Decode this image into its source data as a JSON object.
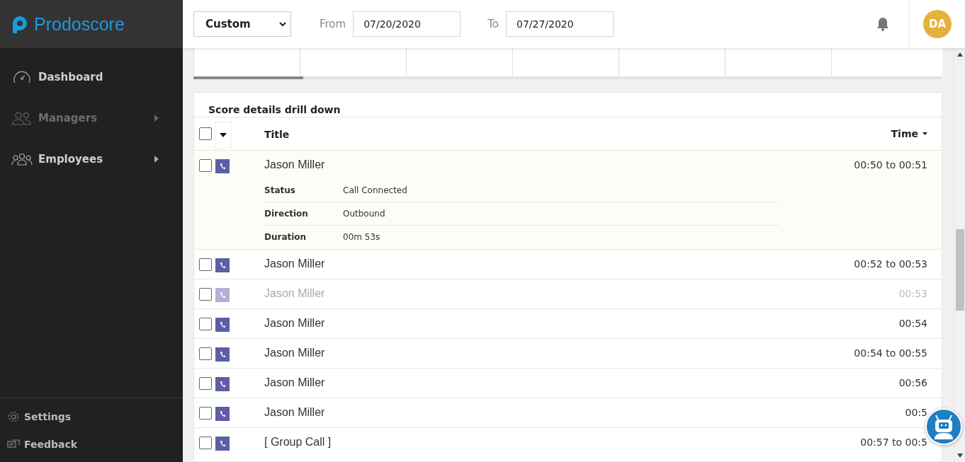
{
  "brand": {
    "name": "Prodoscore"
  },
  "sidebar": {
    "items": [
      {
        "label": "Dashboard",
        "disabled": false,
        "submenu": false
      },
      {
        "label": "Managers",
        "disabled": true,
        "submenu": true
      },
      {
        "label": "Employees",
        "disabled": false,
        "submenu": true
      }
    ],
    "footer": [
      {
        "label": "Settings"
      },
      {
        "label": "Feedback"
      }
    ]
  },
  "topbar": {
    "range": "Custom",
    "from_label": "From",
    "from": "07/20/2020",
    "to_label": "To",
    "to": "07/27/2020",
    "avatar": "DA"
  },
  "drilldown": {
    "title": "Score details drill down",
    "select_all": {
      "checked": false
    },
    "columns": {
      "title": "Title",
      "time": "Time"
    },
    "rows": [
      {
        "title": "Jason Miller",
        "time": "00:50 to 00:51",
        "checked": false,
        "disabled": false,
        "expanded": true,
        "details": [
          {
            "label": "Status",
            "value": "Call Connected"
          },
          {
            "label": "Direction",
            "value": "Outbound"
          },
          {
            "label": "Duration",
            "value": "00m 53s"
          }
        ]
      },
      {
        "title": "Jason Miller",
        "time": "00:52 to 00:53",
        "checked": false,
        "disabled": false,
        "expanded": false
      },
      {
        "title": "Jason Miller",
        "time": "00:53",
        "checked": false,
        "disabled": true,
        "expanded": false
      },
      {
        "title": "Jason Miller",
        "time": "00:54",
        "checked": false,
        "disabled": false,
        "expanded": false
      },
      {
        "title": "Jason Miller",
        "time": "00:54 to 00:55",
        "checked": false,
        "disabled": false,
        "expanded": false
      },
      {
        "title": "Jason Miller",
        "time": "00:56",
        "checked": false,
        "disabled": false,
        "expanded": false
      },
      {
        "title": "Jason Miller",
        "time": "00:5",
        "checked": false,
        "disabled": false,
        "expanded": false
      },
      {
        "title": "[ Group Call ]",
        "time": "00:57 to 00:5",
        "checked": false,
        "disabled": false,
        "expanded": false
      }
    ]
  }
}
